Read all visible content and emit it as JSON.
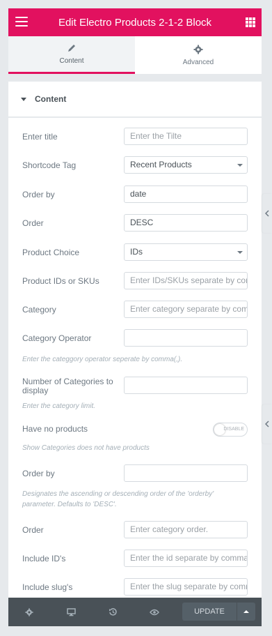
{
  "header": {
    "title": "Edit Electro Products 2-1-2 Block"
  },
  "tabs": [
    {
      "label": "Content",
      "icon": "pencil-icon",
      "active": true
    },
    {
      "label": "Advanced",
      "icon": "gear-icon",
      "active": false
    }
  ],
  "section": {
    "title": "Content"
  },
  "fields": {
    "title": {
      "label": "Enter title",
      "placeholder": "Enter the Tilte"
    },
    "shortcode": {
      "label": "Shortcode Tag",
      "value": "Recent Products"
    },
    "orderby": {
      "label": "Order by",
      "value": "date"
    },
    "order": {
      "label": "Order",
      "value": "DESC"
    },
    "choice": {
      "label": "Product Choice",
      "value": "IDs"
    },
    "ids": {
      "label": "Product IDs or SKUs",
      "placeholder": "Enter IDs/SKUs separate by comma(,)."
    },
    "category": {
      "label": "Category",
      "placeholder": "Enter category separate by comma(,)."
    },
    "catop": {
      "label": "Category Operator",
      "value": "",
      "desc": "Enter the categgory operator seperate by comma(,)."
    },
    "numcat": {
      "label": "Number of Categories to display",
      "value": "",
      "desc": "Enter the category limit."
    },
    "noproducts": {
      "label": "Have no products",
      "toggle": "DISABLE",
      "desc": "Show Categories does not have products"
    },
    "cat_orderby": {
      "label": "Order by",
      "value": "",
      "desc": "Designates the ascending or descending order of the 'orderby' parameter. Defaults to 'DESC'."
    },
    "cat_order": {
      "label": "Order",
      "placeholder": "Enter category order."
    },
    "include_ids": {
      "label": "Include ID's",
      "placeholder": "Enter the id separate by comma(,)."
    },
    "include_slugs": {
      "label": "Include slug's",
      "placeholder": "Enter the slug separate by comma(,)."
    }
  },
  "footer": {
    "update_label": "UPDATE"
  },
  "colors": {
    "accent": "#e2115f",
    "footer": "#495157"
  }
}
